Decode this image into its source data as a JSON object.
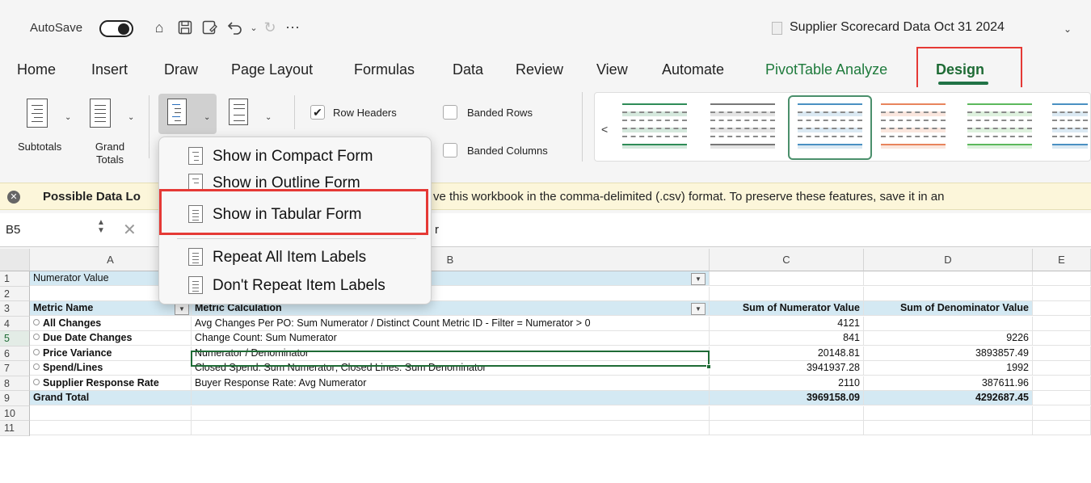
{
  "titlebar": {
    "autosave_label": "AutoSave",
    "document_title": "Supplier Scorecard Data Oct 31 2024"
  },
  "tabs": [
    {
      "label": "Home"
    },
    {
      "label": "Insert"
    },
    {
      "label": "Draw"
    },
    {
      "label": "Page Layout"
    },
    {
      "label": "Formulas"
    },
    {
      "label": "Data"
    },
    {
      "label": "Review"
    },
    {
      "label": "View"
    },
    {
      "label": "Automate"
    },
    {
      "label": "PivotTable Analyze"
    },
    {
      "label": "Design"
    }
  ],
  "ribbon": {
    "subtotals_label": "Subtotals",
    "grand_totals_label": "Grand\nTotals",
    "row_headers_label": "Row Headers",
    "banded_rows_label": "Banded Rows",
    "banded_columns_label": "Banded Columns",
    "row_headers_checked": true,
    "style_colors": [
      "#2e8b57",
      "#777777",
      "#4a90c2",
      "#e8845c",
      "#5cb85c",
      "#4a90c2"
    ]
  },
  "layout_menu": {
    "items": [
      {
        "label": "Show in Compact Form"
      },
      {
        "label": "Show in Outline Form"
      },
      {
        "label": "Show in Tabular Form"
      },
      {
        "label": "Repeat All Item Labels"
      },
      {
        "label": "Don't Repeat Item Labels"
      }
    ]
  },
  "notification": {
    "title": "Possible Data Lo",
    "text": "ve this workbook in the comma-delimited (.csv) format. To preserve these features, save it in an"
  },
  "formula_bar": {
    "name_box": "B5",
    "formula": "r"
  },
  "sheet": {
    "columns": [
      "A",
      "B",
      "C",
      "D",
      "E"
    ],
    "rows": [
      "1",
      "2",
      "3",
      "4",
      "5",
      "6",
      "7",
      "8",
      "9",
      "10",
      "11"
    ],
    "filter_label": "Numerator Value",
    "headers": [
      "Metric Name",
      "Metric Calculation",
      "Sum of Numerator Value",
      "Sum of Denominator Value"
    ],
    "data_rows": [
      {
        "name": "All Changes",
        "calc": "Avg Changes Per PO: Sum Numerator / Distinct Count Metric ID - Filter = Numerator > 0",
        "num": "4121",
        "den": ""
      },
      {
        "name": "Due Date Changes",
        "calc": "Change Count: Sum Numerator",
        "num": "841",
        "den": "9226"
      },
      {
        "name": "Price Variance",
        "calc": "Numerator / Denominator",
        "num": "20148.81",
        "den": "3893857.49"
      },
      {
        "name": "Spend/Lines",
        "calc": "Closed Spend: Sum Numerator; Closed Lines: Sum Denominator",
        "num": "3941937.28",
        "den": "1992"
      },
      {
        "name": "Supplier Response Rate",
        "calc": "Buyer Response Rate: Avg Numerator",
        "num": "2110",
        "den": "387611.96"
      }
    ],
    "grand_total": {
      "label": "Grand Total",
      "num": "3969158.09",
      "den": "4292687.45"
    }
  }
}
